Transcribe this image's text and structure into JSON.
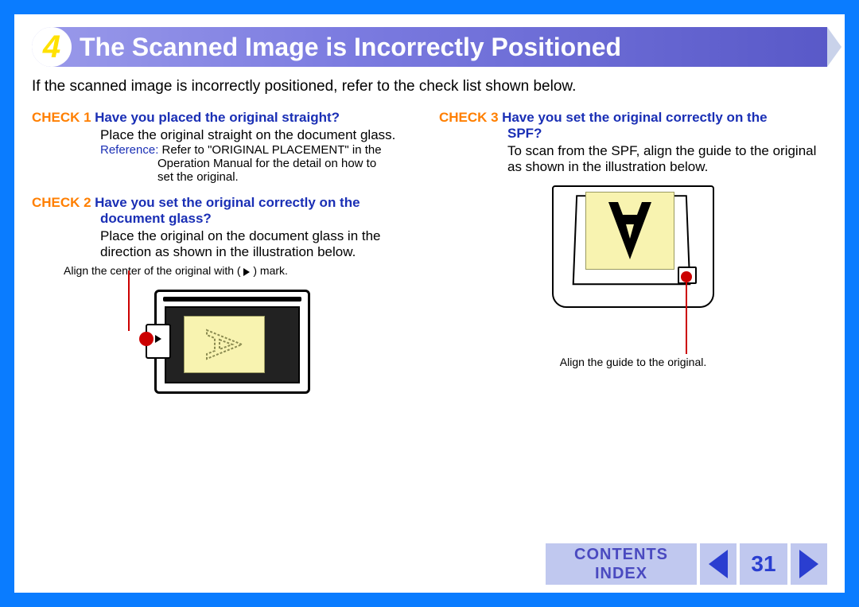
{
  "chapter_number": "4",
  "title": "The Scanned Image is Incorrectly Positioned",
  "intro": "If the scanned image is incorrectly positioned, refer to the check list shown below.",
  "check1": {
    "label": "CHECK 1",
    "question": "Have you placed the original straight?",
    "body": "Place the original straight on the document glass.",
    "reference_label": "Reference:",
    "reference_text_a": "Refer to \"ORIGINAL PLACEMENT\" in the",
    "reference_text_b": "Operation Manual for the detail on how to",
    "reference_text_c": "set the original."
  },
  "check2": {
    "label": "CHECK 2",
    "question_a": "Have you set the original correctly on the",
    "question_b": "document glass?",
    "body_a": "Place the original on the document glass in the",
    "body_b": "direction as shown in the illustration below.",
    "note_prefix": "Align the center of the original with (",
    "note_suffix": ") mark."
  },
  "check3": {
    "label": "CHECK 3",
    "question_a": "Have you set the original correctly on the",
    "question_b": "SPF?",
    "body_a": "To scan from the SPF, align the guide to the original",
    "body_b": "as shown in the illustration below.",
    "note": "Align the guide to the original."
  },
  "footer": {
    "contents": "CONTENTS",
    "index": "INDEX",
    "page": "31"
  }
}
